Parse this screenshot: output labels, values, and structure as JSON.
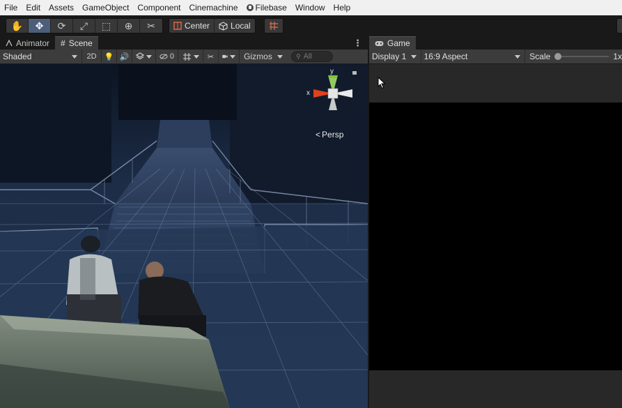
{
  "menubar": {
    "items": [
      "File",
      "Edit",
      "Assets",
      "GameObject",
      "Component",
      "Cinemachine",
      "Filebase",
      "Window",
      "Help"
    ]
  },
  "toolbar": {
    "tools": [
      {
        "name": "hand-tool",
        "icon": "hand-icon",
        "glyph": "✋"
      },
      {
        "name": "move-tool",
        "icon": "move-icon",
        "glyph": "✥",
        "active": true
      },
      {
        "name": "rotate-tool",
        "icon": "rotate-icon",
        "glyph": "⟳"
      },
      {
        "name": "scale-tool",
        "icon": "scale-icon",
        "glyph": "⤢"
      },
      {
        "name": "rect-tool",
        "icon": "rect-icon",
        "glyph": "⬚"
      },
      {
        "name": "transform-tool",
        "icon": "transform-icon",
        "glyph": "⊕"
      },
      {
        "name": "custom-tool",
        "icon": "wrench-icon",
        "glyph": "✂"
      }
    ],
    "pivot_label": "Center",
    "space_label": "Local"
  },
  "scene": {
    "tabs": [
      "Animator",
      "Scene"
    ],
    "shading": "Shaded",
    "mode_2d": "2D",
    "hidden_count": "0",
    "gizmos_label": "Gizmos",
    "search_placeholder": "All",
    "gizmo_axes": {
      "y": "y",
      "x": "x"
    },
    "projection": "Persp"
  },
  "game": {
    "tab": "Game",
    "display": "Display 1",
    "aspect": "16:9 Aspect",
    "scale_label": "Scale",
    "scale_value": "1x"
  },
  "colors": {
    "accent_active": "#4c5e7a",
    "toolbar_bg": "#191919",
    "panel_bg": "#3c3c3c",
    "gizmo_y": "#7cc832",
    "gizmo_x": "#e0401c"
  }
}
